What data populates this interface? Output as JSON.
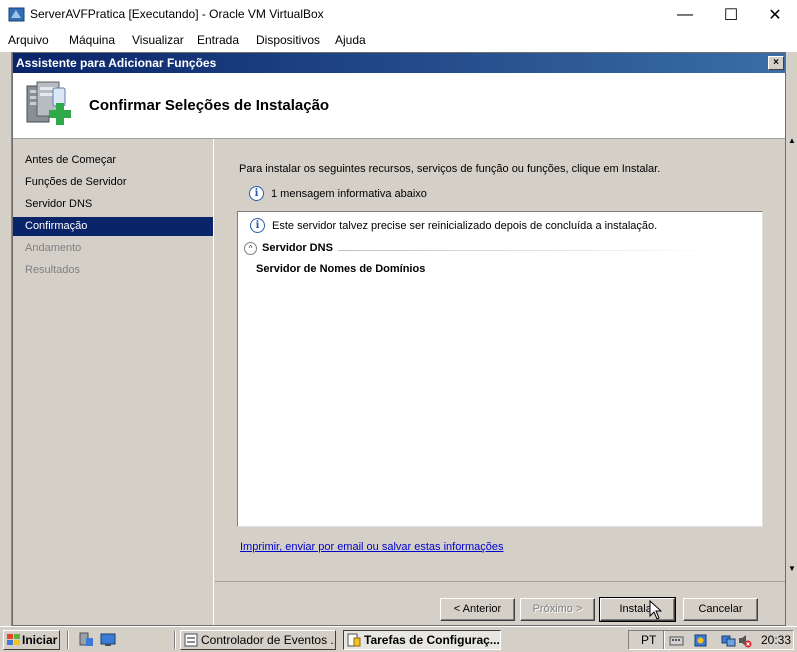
{
  "host_window": {
    "title": "ServerAVFPratica [Executando] - Oracle VM VirtualBox",
    "minimize": "—",
    "maximize": "☐",
    "close": "✕"
  },
  "host_menu": {
    "items": [
      "Arquivo",
      "Máquina",
      "Visualizar",
      "Entrada",
      "Dispositivos",
      "Ajuda"
    ]
  },
  "wizard": {
    "title": "Assistente para Adicionar Funções",
    "close_glyph": "×",
    "heading": "Confirmar Seleções de Instalação",
    "nav": [
      {
        "label": "Antes de Começar",
        "state": "done"
      },
      {
        "label": "Funções de Servidor",
        "state": "done"
      },
      {
        "label": "Servidor DNS",
        "state": "done"
      },
      {
        "label": "Confirmação",
        "state": "active"
      },
      {
        "label": "Andamento",
        "state": "pending"
      },
      {
        "label": "Resultados",
        "state": "pending"
      }
    ],
    "intro": "Para instalar os seguintes recursos, serviços de função ou funções, clique em Instalar.",
    "message_count": "1 mensagem informativa abaixo",
    "info_glyph": "i",
    "details": {
      "warning": "Este servidor talvez precise ser reinicializado depois de concluída a instalação.",
      "collapse_glyph": "^",
      "section_title": "Servidor DNS",
      "section_item": "Servidor de Nomes de Domínios"
    },
    "print_link": "Imprimir, enviar por email ou salvar estas informações",
    "buttons": {
      "previous": "< Anterior",
      "next": "Próximo >",
      "install": "Instalar",
      "cancel": "Cancelar"
    }
  },
  "taskbar": {
    "start_label": "Iniciar",
    "tasks": [
      {
        "label": "Controlador de Eventos ...",
        "active": false
      },
      {
        "label": "Tarefas de Configuraç...",
        "active": true
      }
    ],
    "language": "PT",
    "clock": "20:33"
  },
  "colors": {
    "dialog_title_start": "#0a246a",
    "dialog_title_end": "#3a6ea5",
    "nav_selected": "#0a246a",
    "link": "#0000cc",
    "face": "#d4d0c8"
  }
}
